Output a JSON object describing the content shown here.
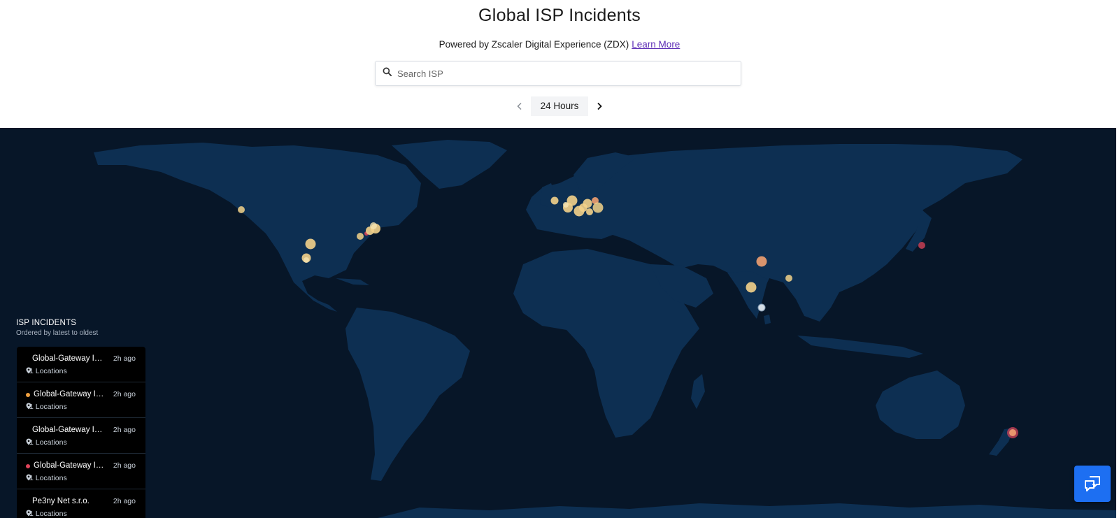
{
  "header": {
    "title": "Global ISP Incidents",
    "powered_by": "Powered by Zscaler Digital Experience (ZDX)",
    "learn_more": "Learn More"
  },
  "search": {
    "placeholder": "Search ISP",
    "value": ""
  },
  "time_range": {
    "label": "24 Hours"
  },
  "colors": {
    "map_background": "#071628",
    "land": "#0d2f52",
    "incident_light": "#f3d28a",
    "incident_orange": "#f0a070",
    "incident_red": "#e0445a",
    "incident_white": "#dfe8f0",
    "chat_button": "#1d6ff2"
  },
  "panel": {
    "title": "ISP INCIDENTS",
    "subtitle": "Ordered by latest to oldest",
    "items": [
      {
        "name": "Global-Gateway Internet",
        "time": "2h ago",
        "locations": "1 Locations",
        "status": "none"
      },
      {
        "name": "Global-Gateway Internet",
        "time": "2h ago",
        "locations": "1 Locations",
        "status": "orange"
      },
      {
        "name": "Global-Gateway Internet",
        "time": "2h ago",
        "locations": "1 Locations",
        "status": "none"
      },
      {
        "name": "Global-Gateway Internet",
        "time": "2h ago",
        "locations": "1 Locations",
        "status": "red"
      },
      {
        "name": "Pe3ny Net s.r.o.",
        "time": "2h ago",
        "locations": "1 Locations",
        "status": "none"
      }
    ]
  },
  "icons": {
    "search": "search-icon",
    "prev": "chevron-left-icon",
    "next": "chevron-right-icon",
    "location": "map-pin-icon",
    "chat": "chat-bubbles-icon"
  }
}
